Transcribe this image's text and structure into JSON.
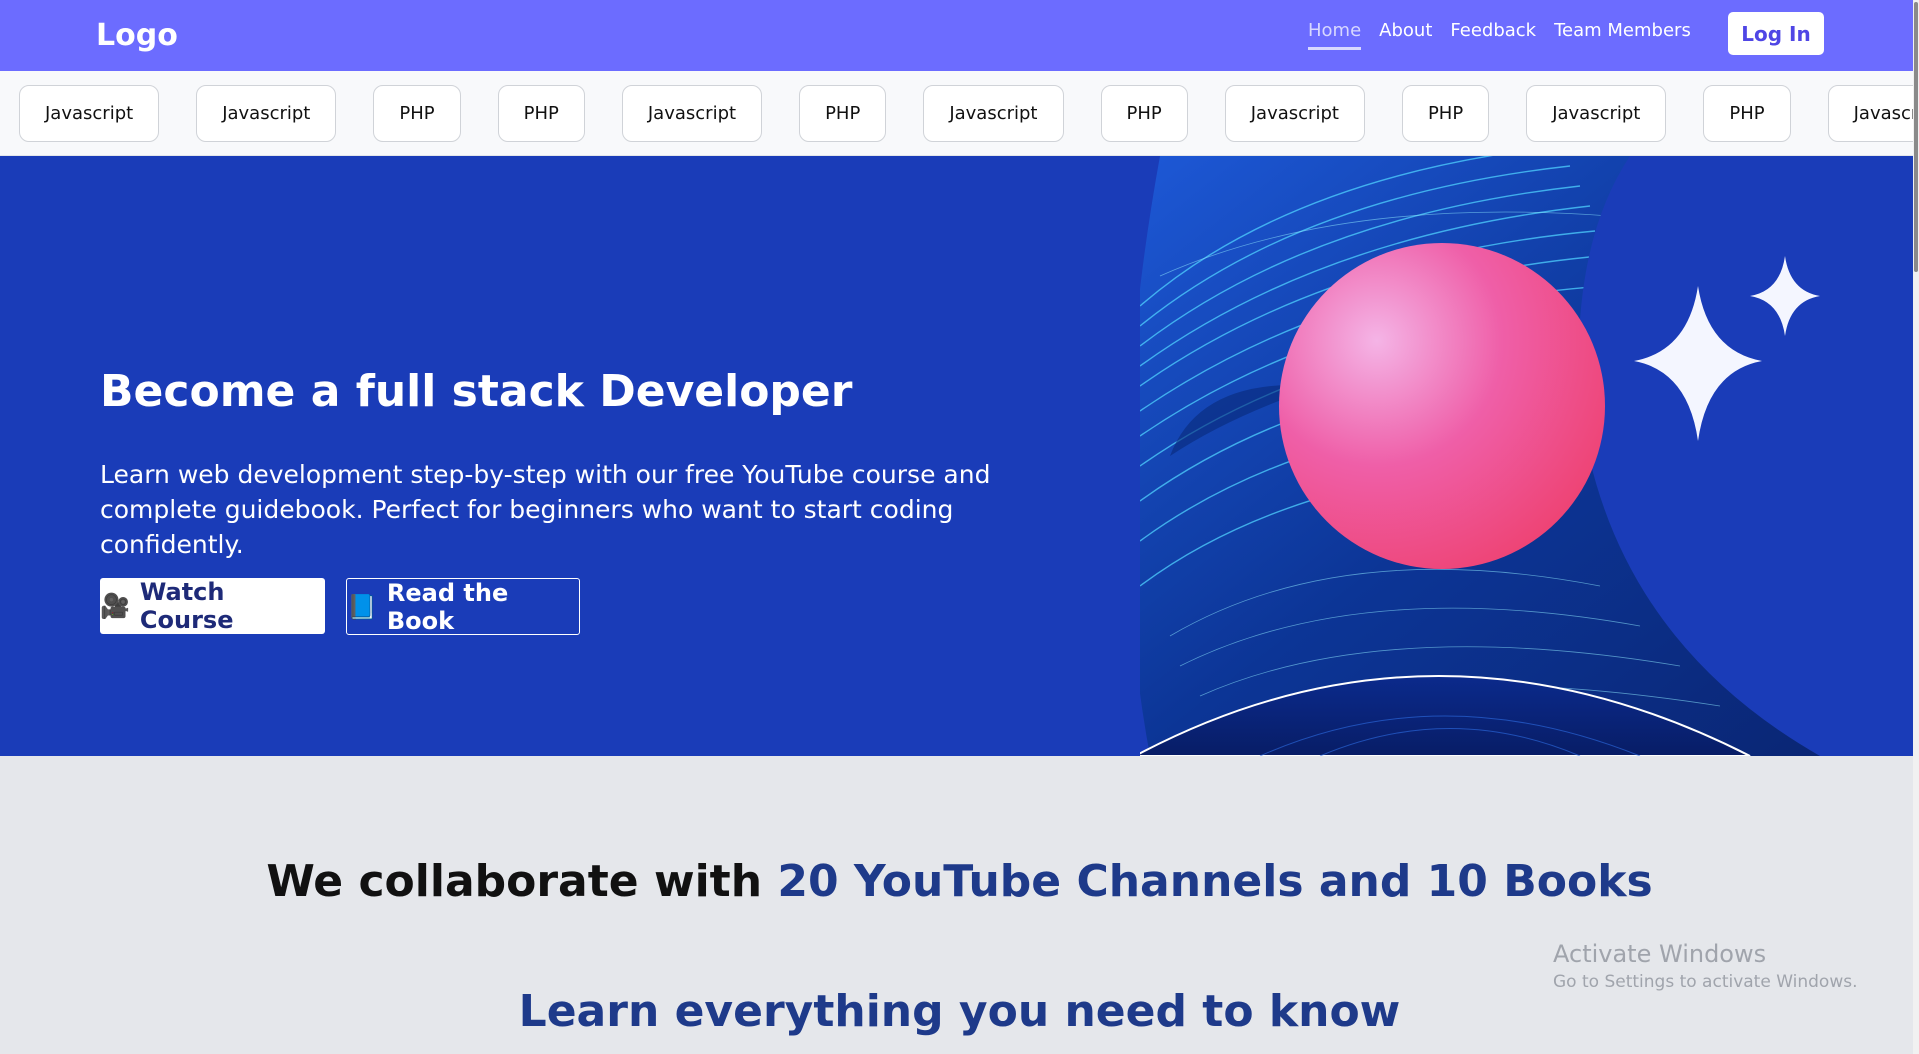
{
  "navbar": {
    "logo": "Logo",
    "links": [
      {
        "label": "Home",
        "active": true
      },
      {
        "label": "About"
      },
      {
        "label": "Feedback"
      },
      {
        "label": "Team Members"
      }
    ],
    "login_label": "Log In",
    "color": "#6c6cff"
  },
  "tags": [
    "Javascript",
    "Javascript",
    "PHP",
    "PHP",
    "Javascript",
    "PHP",
    "Javascript",
    "PHP",
    "Javascript",
    "PHP",
    "Javascript",
    "PHP",
    "Javascript"
  ],
  "hero": {
    "title": "Become a full stack Developer",
    "description": "Learn web development step-by-step with our free YouTube course and complete guidebook. Perfect for beginners who want to start coding confidently.",
    "watch_icon": "🎥",
    "watch_label": "Watch Course",
    "book_icon": "📘",
    "book_label": "Read the Book",
    "background": "#1a3cb8"
  },
  "collab": {
    "prefix": "We collaborate with ",
    "highlight": "20 YouTube Channels and 10 Books"
  },
  "learn": {
    "title": "Learn everything you need to know"
  },
  "watermark": {
    "title": "Activate Windows",
    "subtitle": "Go to Settings to activate Windows."
  }
}
